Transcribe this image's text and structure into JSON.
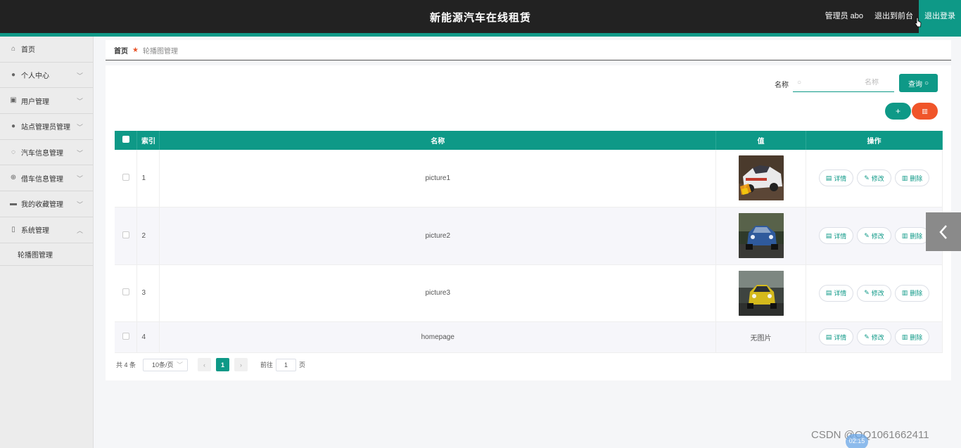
{
  "header": {
    "title": "新能源汽车在线租赁",
    "user_label": "管理员 abo",
    "front_label": "退出到前台",
    "logout_label": "退出登录"
  },
  "sidebar": {
    "items": [
      {
        "label": "首页",
        "icon": "home-icon"
      },
      {
        "label": "个人中心",
        "icon": "user-icon"
      },
      {
        "label": "用户管理",
        "icon": "clipboard-icon"
      },
      {
        "label": "站点管理员管理",
        "icon": "location-icon"
      },
      {
        "label": "汽车信息管理",
        "icon": "power-icon"
      },
      {
        "label": "借车信息管理",
        "icon": "globe-icon"
      },
      {
        "label": "我的收藏管理",
        "icon": "briefcase-icon"
      },
      {
        "label": "系统管理",
        "icon": "mic-icon"
      }
    ],
    "submenu": "轮播图管理"
  },
  "breadcrumb": {
    "home": "首页",
    "current": "轮播图管理"
  },
  "search": {
    "label": "名称",
    "placeholder": "名称",
    "button": "查询"
  },
  "table": {
    "headers": [
      "索引",
      "名称",
      "值",
      "操作"
    ],
    "rows": [
      {
        "index": "1",
        "name": "picture1",
        "value": "image",
        "no_image": ""
      },
      {
        "index": "2",
        "name": "picture2",
        "value": "image",
        "no_image": ""
      },
      {
        "index": "3",
        "name": "picture3",
        "value": "image",
        "no_image": ""
      },
      {
        "index": "4",
        "name": "homepage",
        "value": "",
        "no_image": "无图片"
      }
    ],
    "actions": {
      "detail": "详情",
      "edit": "修改",
      "delete": "删除"
    }
  },
  "pagination": {
    "total": "共 4 条",
    "page_size": "10条/页",
    "current_page": "1",
    "goto_label": "前往",
    "goto_value": "1",
    "page_suffix": "页"
  },
  "overlay": {
    "watermark": "CSDN @QQ1061662411",
    "timer": "02:15"
  },
  "colors": {
    "accent": "#0e9987",
    "danger": "#f0552a",
    "header": "#222222"
  }
}
